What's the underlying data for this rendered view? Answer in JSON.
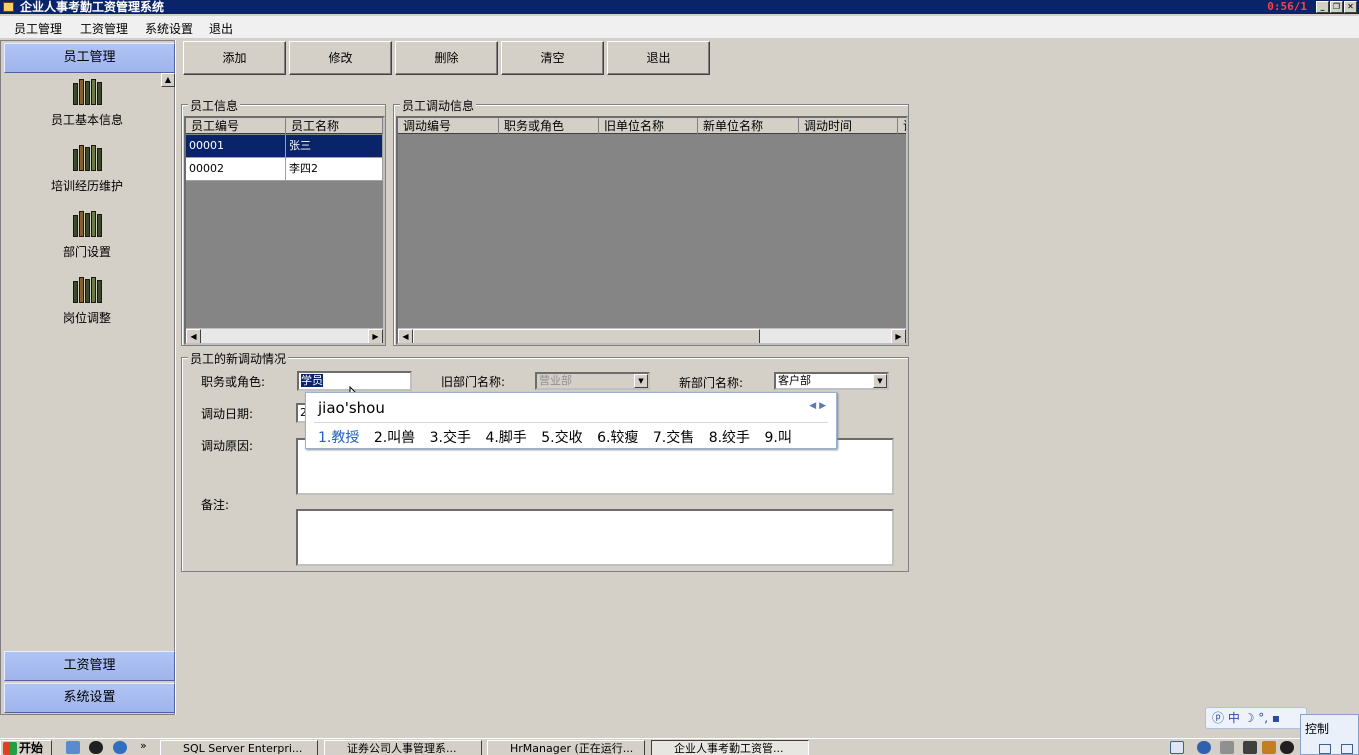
{
  "window": {
    "title": "企业人事考勤工资管理系统",
    "clock": "0:56/1"
  },
  "menu": [
    "员工管理",
    "工资管理",
    "系统设置",
    "退出"
  ],
  "sidebar": {
    "top_header": "员工管理",
    "items": [
      "员工基本信息",
      "培训经历维护",
      "部门设置",
      "岗位调整"
    ],
    "bottom_headers": [
      "工资管理",
      "系统设置"
    ]
  },
  "toolbar": {
    "add": "添加",
    "edit": "修改",
    "delete": "删除",
    "clear": "清空",
    "exit": "退出"
  },
  "employee_info": {
    "title": "员工信息",
    "columns": [
      "员工编号",
      "员工名称"
    ],
    "rows": [
      [
        "00001",
        "张三"
      ],
      [
        "00002",
        "李四2"
      ]
    ]
  },
  "transfer_info": {
    "title": "员工调动信息",
    "columns": [
      "调动编号",
      "职务或角色",
      "旧单位名称",
      "新单位名称",
      "调动时间",
      "调"
    ]
  },
  "new_transfer": {
    "title": "员工的新调动情况",
    "role_label": "职务或角色:",
    "role_value": "学员",
    "old_dept_label": "旧部门名称:",
    "old_dept_value": "营业部",
    "new_dept_label": "新部门名称:",
    "new_dept_value": "客户部",
    "date_label": "调动日期:",
    "date_value": "2",
    "reason_label": "调动原因:",
    "remark_label": "备注:"
  },
  "ime": {
    "pinyin": "jiao'shou",
    "candidates": [
      "1.教授",
      "2.叫兽",
      "3.交手",
      "4.脚手",
      "5.交收",
      "6.较瘦",
      "7.交售",
      "8.绞手",
      "9.叫"
    ]
  },
  "taskbar": {
    "start": "开始",
    "tasks": [
      "SQL Server Enterpri...",
      "证券公司人事管理系...",
      "HrManager (正在运行...",
      "企业人事考勤工资管..."
    ],
    "ctrl": "控制"
  }
}
